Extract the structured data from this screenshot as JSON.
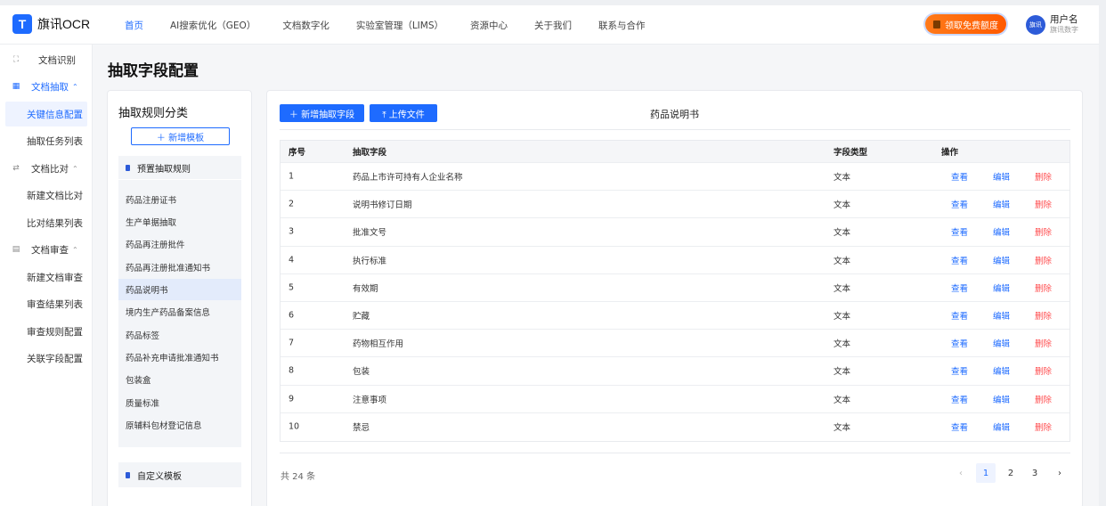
{
  "app": {
    "logo_letter": "T",
    "name": "旗讯OCR"
  },
  "nav": {
    "links": [
      "首页",
      "AI搜索优化（GEO）",
      "文档数字化",
      "实验室管理（LIMS）",
      "资源中心",
      "关于我们",
      "联系与合作"
    ],
    "active_index": 0,
    "promo_label": "领取免费额度",
    "avatar_text": "旗讯",
    "user_name": "用户名",
    "user_org": "旗讯数字"
  },
  "sidebar": {
    "doc_recognition": "文档识别",
    "doc_extract": "文档抽取",
    "key_info_config": "关键信息配置",
    "extract_task_list": "抽取任务列表",
    "doc_compare": "文档比对",
    "new_compare": "新建文档比对",
    "compare_results": "比对结果列表",
    "doc_review": "文档审查",
    "new_review": "新建文档审查",
    "review_results": "审查结果列表",
    "review_rules": "审查规则配置",
    "related_fields": "关联字段配置"
  },
  "page_title": "抽取字段配置",
  "rule_panel": {
    "title": "抽取规则分类",
    "add_template": "＋ 新增模板",
    "preset_section": "预置抽取规则",
    "preset_items": [
      "药品注册证书",
      "生产单据抽取",
      "药品再注册批件",
      "药品再注册批准通知书",
      "药品说明书",
      "境内生产药品备案信息",
      "药品标签",
      "药品补充申请批准通知书",
      "包装盒",
      "质量标准",
      "原辅料包材登记信息"
    ],
    "active_item_index": 4,
    "custom_section": "自定义模板"
  },
  "field_panel": {
    "add_field": "＋ 新增抽取字段",
    "upload": "⤒ 上传文件",
    "title": "药品说明书",
    "headers": {
      "index": "序号",
      "field": "抽取字段",
      "type": "字段类型",
      "actions": "操作"
    },
    "rows": [
      {
        "index": "1",
        "field": "药品上市许可持有人企业名称",
        "type": "文本"
      },
      {
        "index": "2",
        "field": "说明书修订日期",
        "type": "文本"
      },
      {
        "index": "3",
        "field": "批准文号",
        "type": "文本"
      },
      {
        "index": "4",
        "field": "执行标准",
        "type": "文本"
      },
      {
        "index": "5",
        "field": "有效期",
        "type": "文本"
      },
      {
        "index": "6",
        "field": "贮藏",
        "type": "文本"
      },
      {
        "index": "7",
        "field": "药物相互作用",
        "type": "文本"
      },
      {
        "index": "8",
        "field": "包装",
        "type": "文本"
      },
      {
        "index": "9",
        "field": "注意事项",
        "type": "文本"
      },
      {
        "index": "10",
        "field": "禁忌",
        "type": "文本"
      }
    ],
    "action_labels": {
      "view": "查看",
      "edit": "编辑",
      "delete": "删除"
    },
    "total": "共 24 条",
    "pagination": {
      "prev": "‹",
      "pages": [
        "1",
        "2",
        "3"
      ],
      "current": "1",
      "next": "›"
    }
  },
  "colors": {
    "primary": "#1e6bff",
    "danger": "#ff4d4f",
    "promo": "#ff6a00"
  }
}
